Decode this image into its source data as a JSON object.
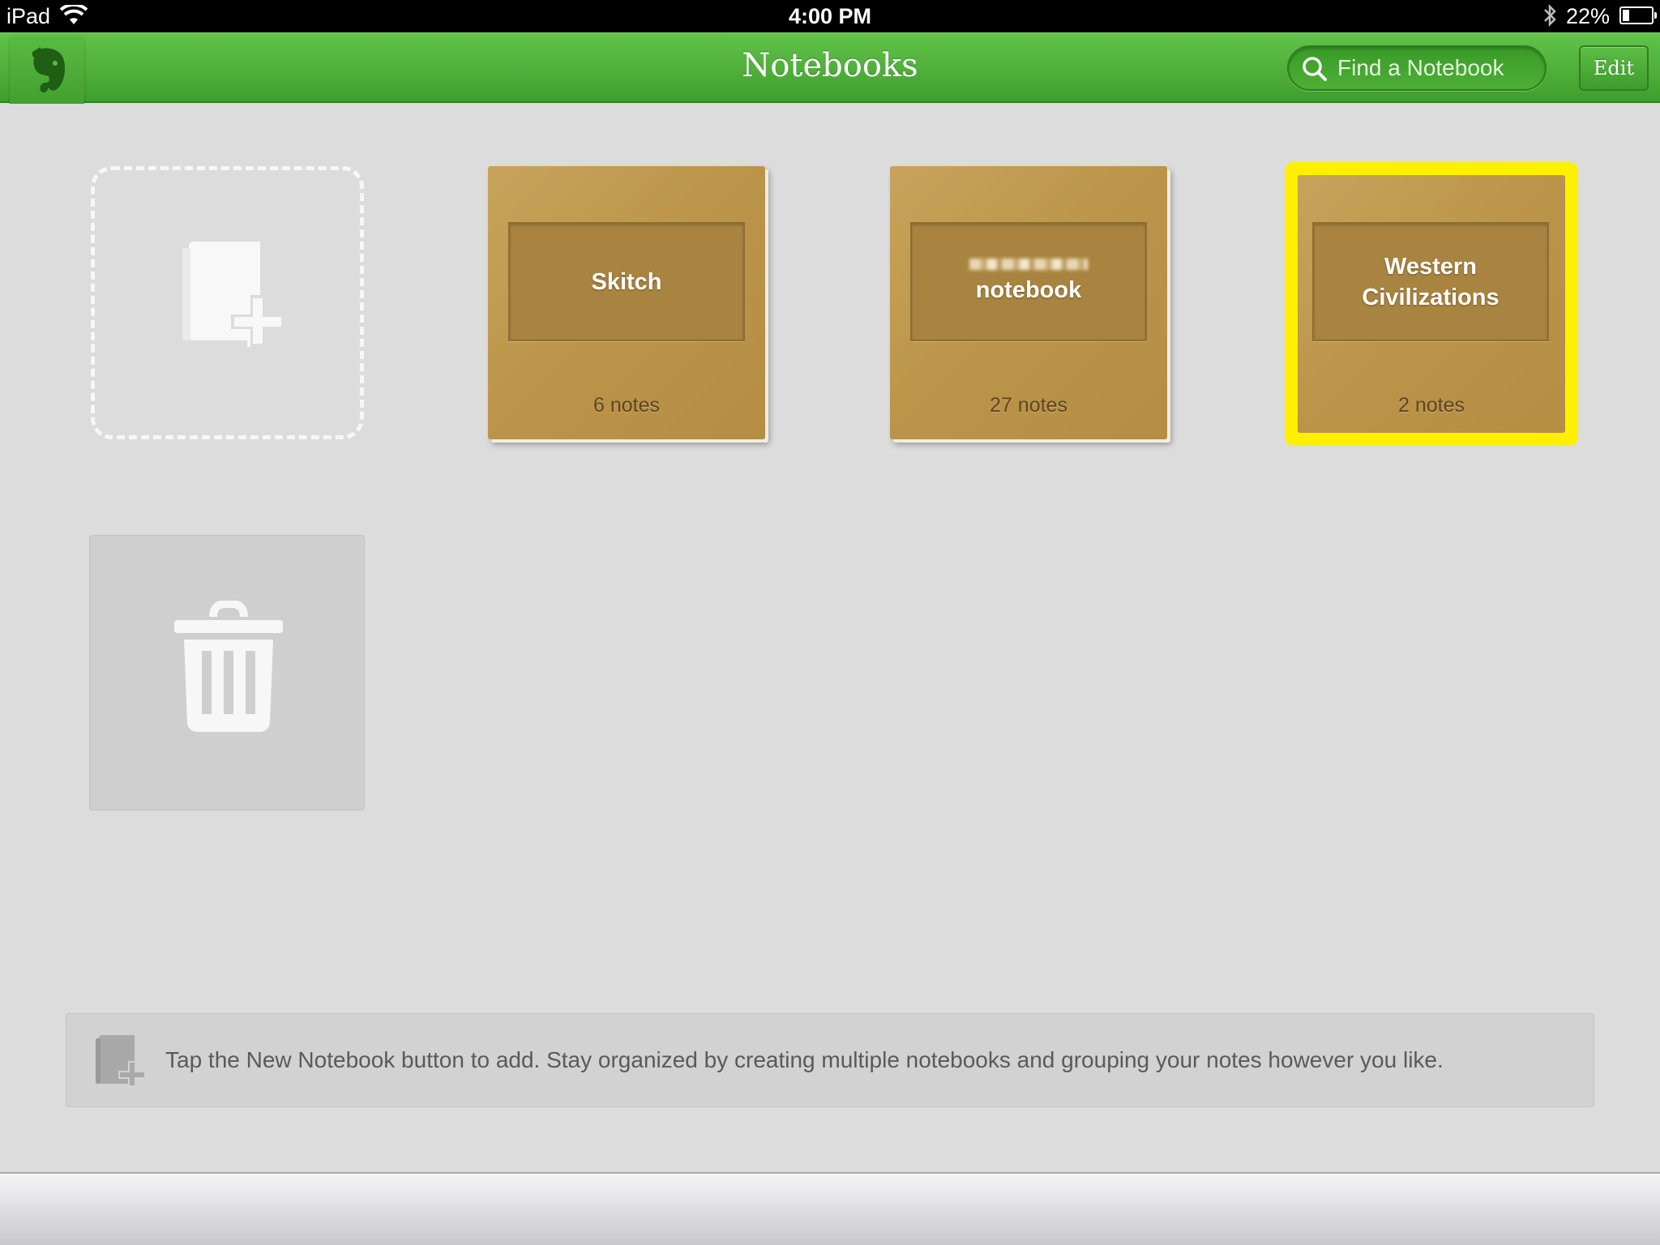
{
  "status_bar": {
    "device": "iPad",
    "time": "4:00 PM",
    "battery": "22%",
    "battery_level": 0.22
  },
  "nav": {
    "title": "Notebooks",
    "search_placeholder": "Find a Notebook",
    "edit_label": "Edit"
  },
  "notebooks": [
    {
      "title": "Skitch",
      "count": "6 notes",
      "highlighted": false
    },
    {
      "title": "notebook",
      "title_prefix_redacted": true,
      "count": "27 notes",
      "highlighted": false
    },
    {
      "title": "Western Civilizations",
      "count": "2 notes",
      "highlighted": true
    }
  ],
  "hint": {
    "text": "Tap the New Notebook button to add. Stay organized by creating multiple notebooks and grouping your notes however you like."
  },
  "colors": {
    "nav_green": "#4db036",
    "notebook_kraft": "#bb9449",
    "highlight": "#ffef00"
  },
  "icons": {
    "logo": "evernote-elephant-icon",
    "search": "search-icon",
    "new_notebook": "new-notebook-icon",
    "trash": "trash-icon",
    "hint": "new-notebook-icon"
  }
}
